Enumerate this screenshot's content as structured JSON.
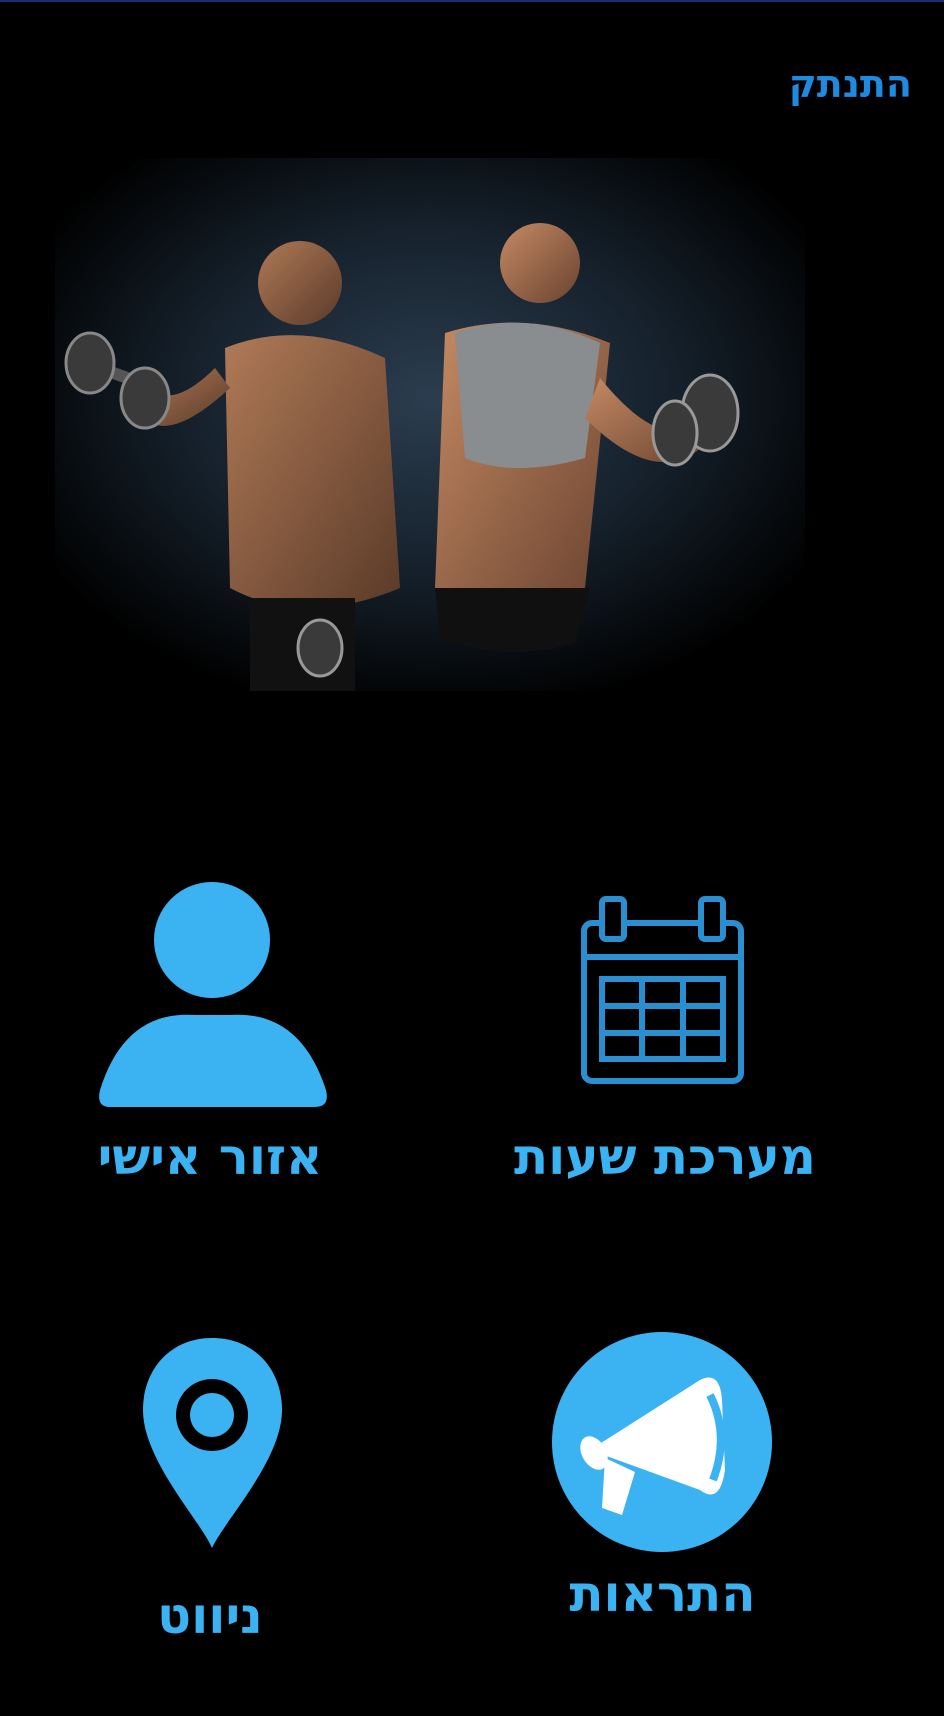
{
  "header": {
    "logout_label": "התנתק"
  },
  "hero": {
    "image_icon": "fitness-couple-dumbbells-photo"
  },
  "tiles": [
    {
      "label": "אזור אישי",
      "icon": "user-icon"
    },
    {
      "label": "מערכת שעות",
      "icon": "calendar-icon"
    },
    {
      "label": "ניווט",
      "icon": "map-pin-icon"
    },
    {
      "label": "התראות",
      "icon": "megaphone-icon"
    }
  ],
  "colors": {
    "background": "#000000",
    "accent": "#3bb3f2",
    "link": "#1e8be0"
  }
}
